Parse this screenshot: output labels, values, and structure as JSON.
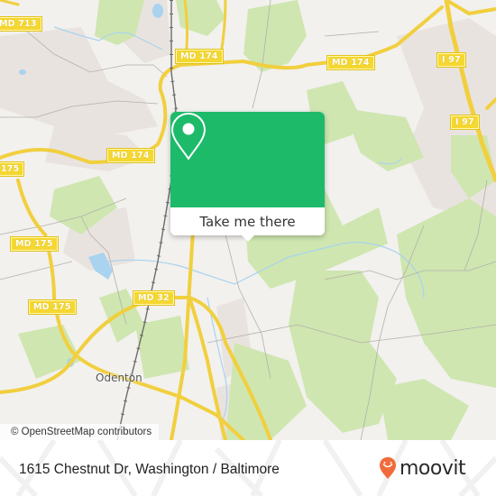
{
  "map": {
    "route_labels": [
      {
        "id": "md713",
        "text": "MD 713"
      },
      {
        "id": "md174-a",
        "text": "MD 174"
      },
      {
        "id": "md174-b",
        "text": "MD 174"
      },
      {
        "id": "md174-c",
        "text": "MD 174"
      },
      {
        "id": "i97-a",
        "text": "I 97"
      },
      {
        "id": "i97-b",
        "text": "I 97"
      },
      {
        "id": "md175-a",
        "text": "175"
      },
      {
        "id": "md175-b",
        "text": "MD 175"
      },
      {
        "id": "md175-c",
        "text": "MD 175"
      },
      {
        "id": "md32",
        "text": "MD 32"
      }
    ],
    "places": [
      {
        "id": "odenton",
        "text": "Odenton"
      }
    ],
    "colors": {
      "land": "#f2f1ee",
      "park": "#cfe6b0",
      "residential": "#e9e3e0",
      "water": "#a9d3ee",
      "road_major": "#f5d731",
      "road_minor": "#aaaaaa",
      "rail": "#666666"
    },
    "attribution": "© OpenStreetMap contributors"
  },
  "popup": {
    "icon": "location-pin-icon",
    "cta_label": "Take me there",
    "accent_color": "#1dba6a"
  },
  "footer": {
    "address": "1615 Chestnut Dr, Washington / Baltimore",
    "brand": "moovit",
    "brand_color": "#f26b3a"
  }
}
